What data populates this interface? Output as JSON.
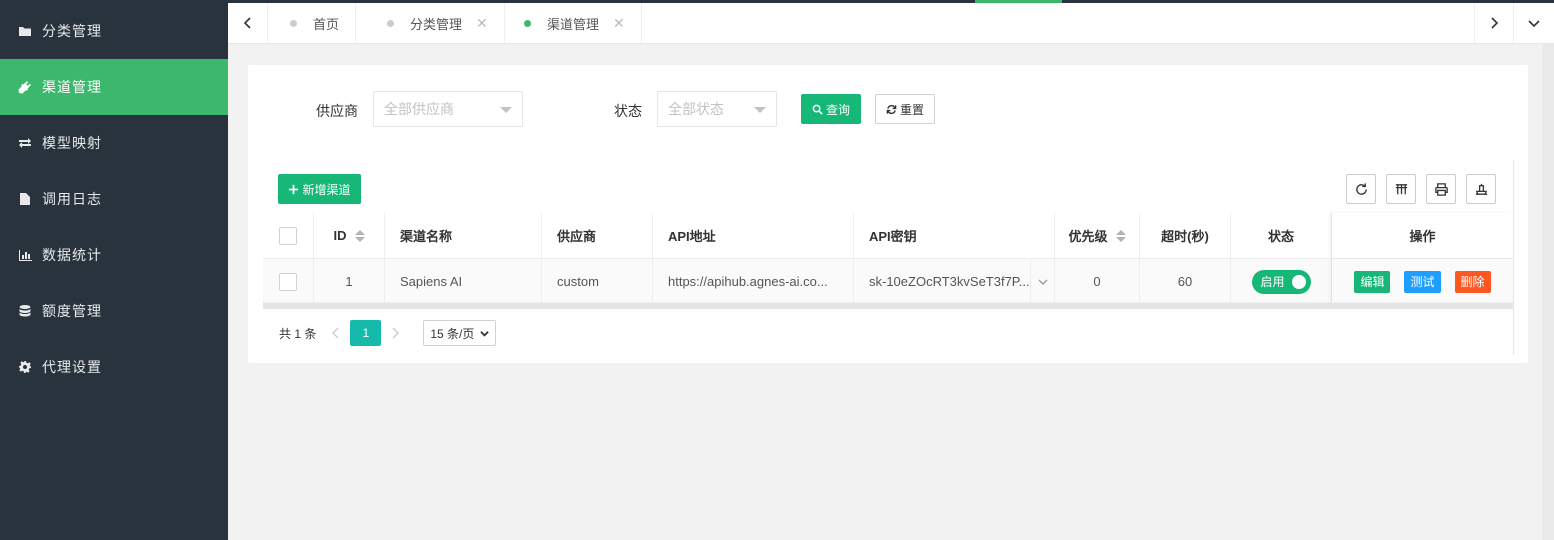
{
  "sidebar": {
    "items": [
      {
        "label": "分类管理",
        "icon": "folder-icon"
      },
      {
        "label": "渠道管理",
        "icon": "plug-icon",
        "active": true
      },
      {
        "label": "模型映射",
        "icon": "exchange-icon"
      },
      {
        "label": "调用日志",
        "icon": "file-icon"
      },
      {
        "label": "数据统计",
        "icon": "bar-chart-icon"
      },
      {
        "label": "额度管理",
        "icon": "database-icon"
      },
      {
        "label": "代理设置",
        "icon": "gear-icon"
      }
    ]
  },
  "tabs": [
    {
      "label": "首页",
      "closable": false
    },
    {
      "label": "分类管理",
      "closable": true
    },
    {
      "label": "渠道管理",
      "closable": true,
      "active": true
    }
  ],
  "filters": {
    "provider_label": "供应商",
    "provider_placeholder": "全部供应商",
    "status_label": "状态",
    "status_placeholder": "全部状态",
    "search_label": "查询",
    "reset_label": "重置"
  },
  "toolbar": {
    "add_label": "新增渠道"
  },
  "table": {
    "headers": {
      "id": "ID",
      "name": "渠道名称",
      "provider": "供应商",
      "api_url": "API地址",
      "api_key": "API密钥",
      "priority": "优先级",
      "timeout": "超时(秒)",
      "status": "状态",
      "actions": "操作"
    },
    "rows": [
      {
        "id": "1",
        "name": "Sapiens AI",
        "provider": "custom",
        "api_url": "https://apihub.agnes-ai.co...",
        "api_key": "sk-10eZOcRT3kvSeT3f7P...",
        "priority": "0",
        "timeout": "60",
        "status": "启用",
        "edit": "编辑",
        "test": "测试",
        "delete": "删除"
      }
    ]
  },
  "pager": {
    "total": "共 1 条",
    "current": "1",
    "page_size": "15 条/页"
  },
  "colors": {
    "sidebar_bg": "#28333e",
    "active_green": "#3bb86b",
    "primary": "#16b777",
    "test_blue": "#1e9fff",
    "danger": "#ff5722",
    "pager_teal": "#16baaa"
  }
}
